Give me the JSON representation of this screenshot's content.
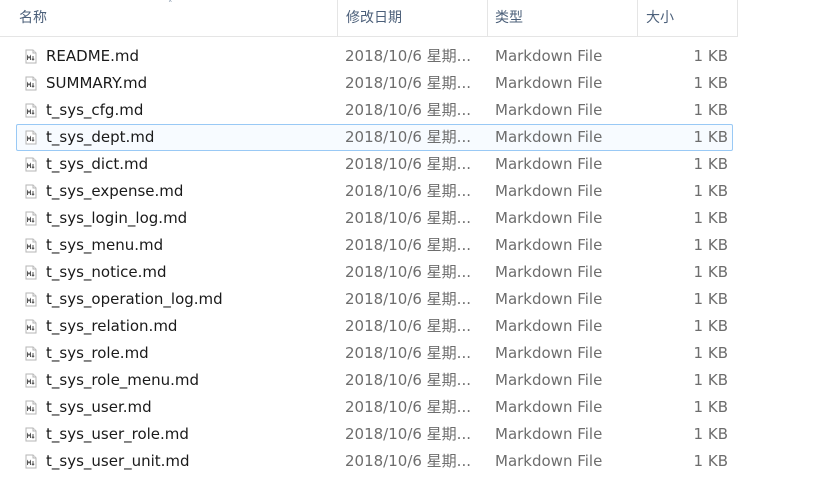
{
  "header": {
    "sort_indicator": "˄",
    "columns": {
      "name": "名称",
      "date": "修改日期",
      "type": "类型",
      "size": "大小"
    }
  },
  "icons": {
    "file": "markdown-file-icon"
  },
  "colors": {
    "selection_border": "#99c9f5",
    "selection_fill": "#f7fbff",
    "header_text": "#4c607a"
  },
  "files": [
    {
      "name": "README.md",
      "date": "2018/10/6 星期...",
      "type": "Markdown File",
      "size": "1 KB"
    },
    {
      "name": "SUMMARY.md",
      "date": "2018/10/6 星期...",
      "type": "Markdown File",
      "size": "1 KB"
    },
    {
      "name": "t_sys_cfg.md",
      "date": "2018/10/6 星期...",
      "type": "Markdown File",
      "size": "1 KB"
    },
    {
      "name": "t_sys_dept.md",
      "date": "2018/10/6 星期...",
      "type": "Markdown File",
      "size": "1 KB",
      "selected": true
    },
    {
      "name": "t_sys_dict.md",
      "date": "2018/10/6 星期...",
      "type": "Markdown File",
      "size": "1 KB"
    },
    {
      "name": "t_sys_expense.md",
      "date": "2018/10/6 星期...",
      "type": "Markdown File",
      "size": "1 KB"
    },
    {
      "name": "t_sys_login_log.md",
      "date": "2018/10/6 星期...",
      "type": "Markdown File",
      "size": "1 KB"
    },
    {
      "name": "t_sys_menu.md",
      "date": "2018/10/6 星期...",
      "type": "Markdown File",
      "size": "1 KB"
    },
    {
      "name": "t_sys_notice.md",
      "date": "2018/10/6 星期...",
      "type": "Markdown File",
      "size": "1 KB"
    },
    {
      "name": "t_sys_operation_log.md",
      "date": "2018/10/6 星期...",
      "type": "Markdown File",
      "size": "1 KB"
    },
    {
      "name": "t_sys_relation.md",
      "date": "2018/10/6 星期...",
      "type": "Markdown File",
      "size": "1 KB"
    },
    {
      "name": "t_sys_role.md",
      "date": "2018/10/6 星期...",
      "type": "Markdown File",
      "size": "1 KB"
    },
    {
      "name": "t_sys_role_menu.md",
      "date": "2018/10/6 星期...",
      "type": "Markdown File",
      "size": "1 KB"
    },
    {
      "name": "t_sys_user.md",
      "date": "2018/10/6 星期...",
      "type": "Markdown File",
      "size": "1 KB"
    },
    {
      "name": "t_sys_user_role.md",
      "date": "2018/10/6 星期...",
      "type": "Markdown File",
      "size": "1 KB"
    },
    {
      "name": "t_sys_user_unit.md",
      "date": "2018/10/6 星期...",
      "type": "Markdown File",
      "size": "1 KB"
    }
  ]
}
